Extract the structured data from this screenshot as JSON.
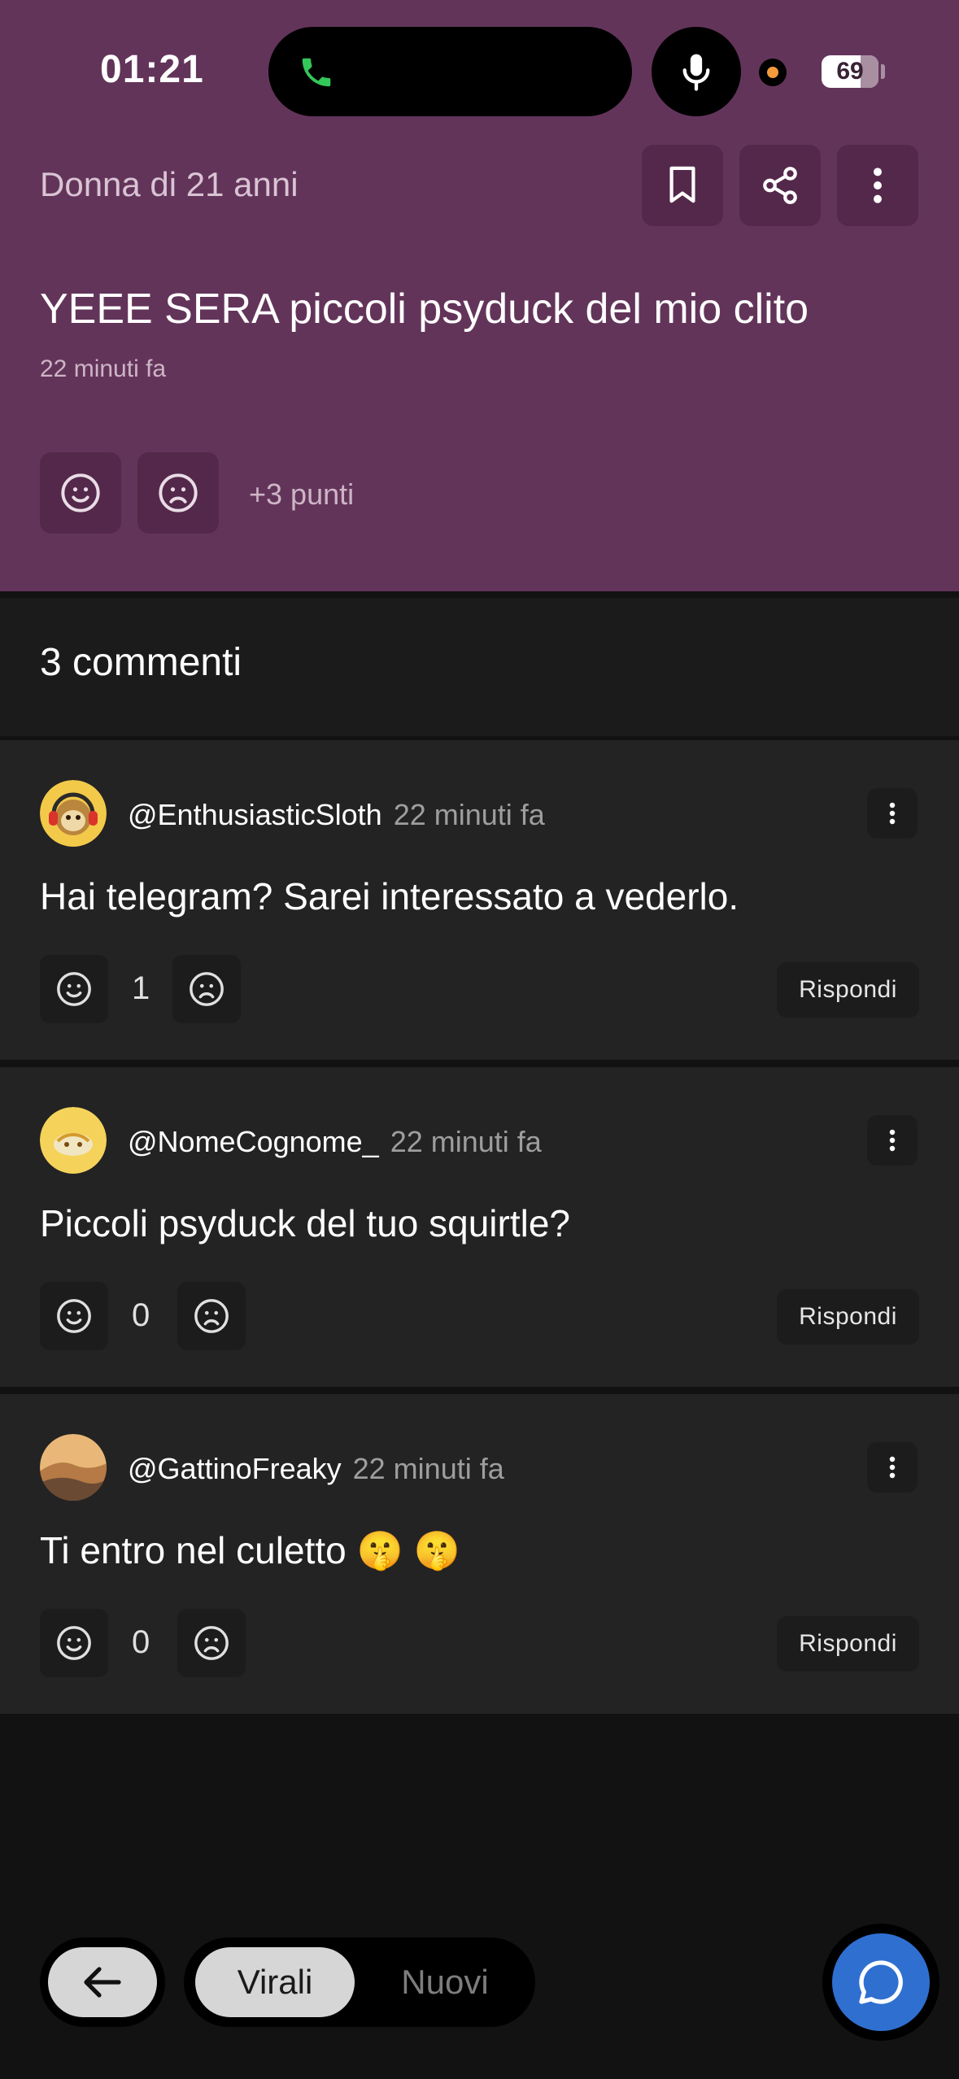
{
  "status_bar": {
    "time": "01:21",
    "battery": "69",
    "battery_level_percent": 69
  },
  "post": {
    "author": "Donna di 21 anni",
    "title": "YEEE SERA piccoli psyduck del mio clito",
    "time": "22 minuti fa",
    "points": "+3 punti",
    "actions": [
      "bookmark-icon",
      "share-icon",
      "more-vertical-icon"
    ]
  },
  "comments_header": "3 commenti",
  "comments": [
    {
      "user": "@EnthusiasticSloth",
      "time": "22 minuti fa",
      "text": "Hai telegram? Sarei interessato a vederlo.",
      "votes": "1",
      "reply": "Rispondi",
      "avatar": "sloth-headphones-avatar"
    },
    {
      "user": "@NomeCognome_",
      "time": "22 minuti fa",
      "text": "Piccoli psyduck del tuo squirtle?",
      "votes": "0",
      "reply": "Rispondi",
      "avatar": "yellow-emoji-avatar"
    },
    {
      "user": "@GattinoFreaky",
      "time": "22 minuti fa",
      "text": "Ti entro nel culetto 🤫 🤫",
      "votes": "0",
      "reply": "Rispondi",
      "avatar": "desert-landscape-avatar"
    }
  ],
  "bottom_bar": {
    "tab_active": "Virali",
    "tab_inactive": "Nuovi"
  },
  "colors": {
    "post_background": "#63345a",
    "card_background": "#232323",
    "fab": "#2f6fd0"
  }
}
